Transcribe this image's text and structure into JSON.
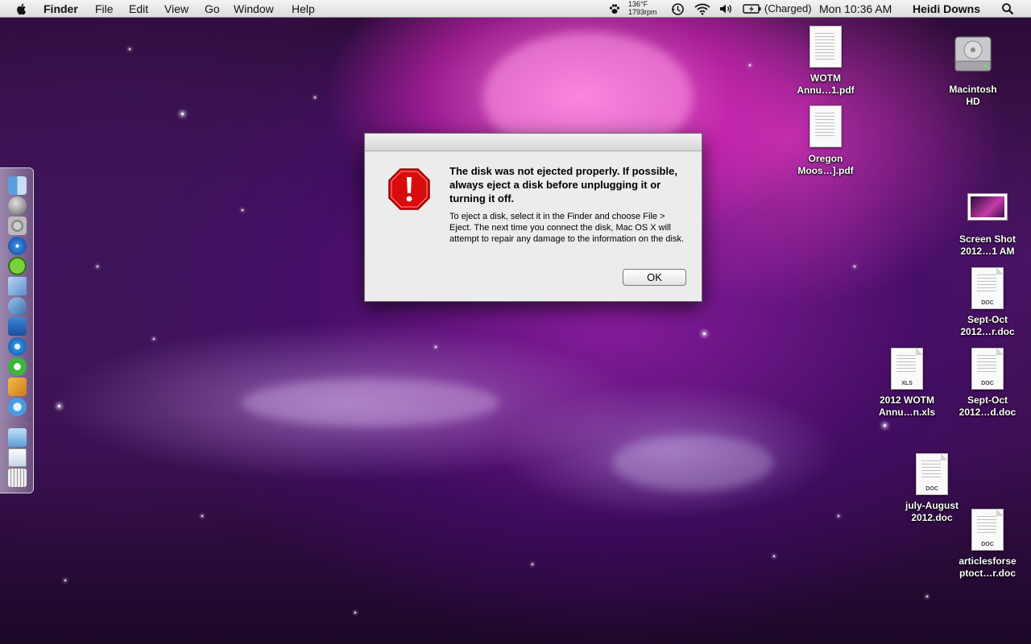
{
  "menubar": {
    "app_name": "Finder",
    "menus": [
      "File",
      "Edit",
      "View",
      "Go",
      "Window",
      "Help"
    ],
    "temperature": "136°F",
    "fan_speed": "1793rpm",
    "battery_status": "(Charged)",
    "clock": "Mon 10:36 AM",
    "user": "Heidi Downs"
  },
  "desktop_icons": [
    {
      "line1": "WOTM",
      "line2": "Annu…1.pdf",
      "kind": "pdf"
    },
    {
      "line1": "Oregon",
      "line2": "Moos…].pdf",
      "kind": "pdf"
    },
    {
      "line1": "Macintosh",
      "line2": "HD",
      "kind": "disk"
    },
    {
      "line1": "Screen Shot",
      "line2": "2012…1 AM",
      "kind": "screenshot"
    },
    {
      "line1": "Sept-Oct",
      "line2": "2012…r.doc",
      "kind": "doc",
      "badge": "DOC"
    },
    {
      "line1": "2012 WOTM",
      "line2": "Annu…n.xls",
      "kind": "xls",
      "badge": "XLS"
    },
    {
      "line1": "Sept-Oct",
      "line2": "2012…d.doc",
      "kind": "doc",
      "badge": "DOC"
    },
    {
      "line1": "july-August",
      "line2": "2012.doc",
      "kind": "doc",
      "badge": "DOC"
    },
    {
      "line1": "articlesforse",
      "line2": "ptoct…r.doc",
      "kind": "doc",
      "badge": "DOC"
    }
  ],
  "dock_icons": [
    "finder-icon",
    "launchpad-icon",
    "system-preferences-icon",
    "safari-icon",
    "spotify-icon",
    "mail-icon",
    "preview-icon",
    "word-icon",
    "itunes-icon",
    "utorrent-icon",
    "iphoto-icon",
    "facetime-icon",
    "applications-folder-icon",
    "documents-stack-icon",
    "trash-icon"
  ],
  "dialog": {
    "heading": "The disk was not ejected properly. If possible, always eject a disk before unplugging it or turning it off.",
    "info": "To eject a disk, select it in the Finder and choose File > Eject. The next time you connect the disk, Mac OS X will attempt to repair any damage to the information on the disk.",
    "ok_label": "OK"
  },
  "colors": {
    "alert_red": "#e01010",
    "wallpaper_magenta": "#e63cbe",
    "wallpaper_purple": "#4a1660"
  }
}
